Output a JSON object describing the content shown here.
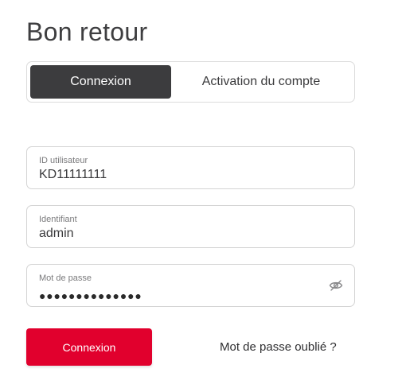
{
  "page": {
    "title": "Bon retour"
  },
  "tabs": [
    {
      "label": "Connexion",
      "active": true
    },
    {
      "label": "Activation du compte",
      "active": false
    }
  ],
  "form": {
    "user_id": {
      "label": "ID utilisateur",
      "value": "KD11111111"
    },
    "login": {
      "label": "Identifiant",
      "value": "admin"
    },
    "password": {
      "label": "Mot de passe",
      "masked_value": "●●●●●●●●●●●●●●",
      "toggle_icon": "eye-slash-icon"
    }
  },
  "actions": {
    "submit_label": "Connexion",
    "forgot_label": "Mot de passe oublié ?"
  },
  "colors": {
    "primary": "#e1002d",
    "active_tab": "#3c3c3e",
    "border": "#d4d4d4"
  }
}
